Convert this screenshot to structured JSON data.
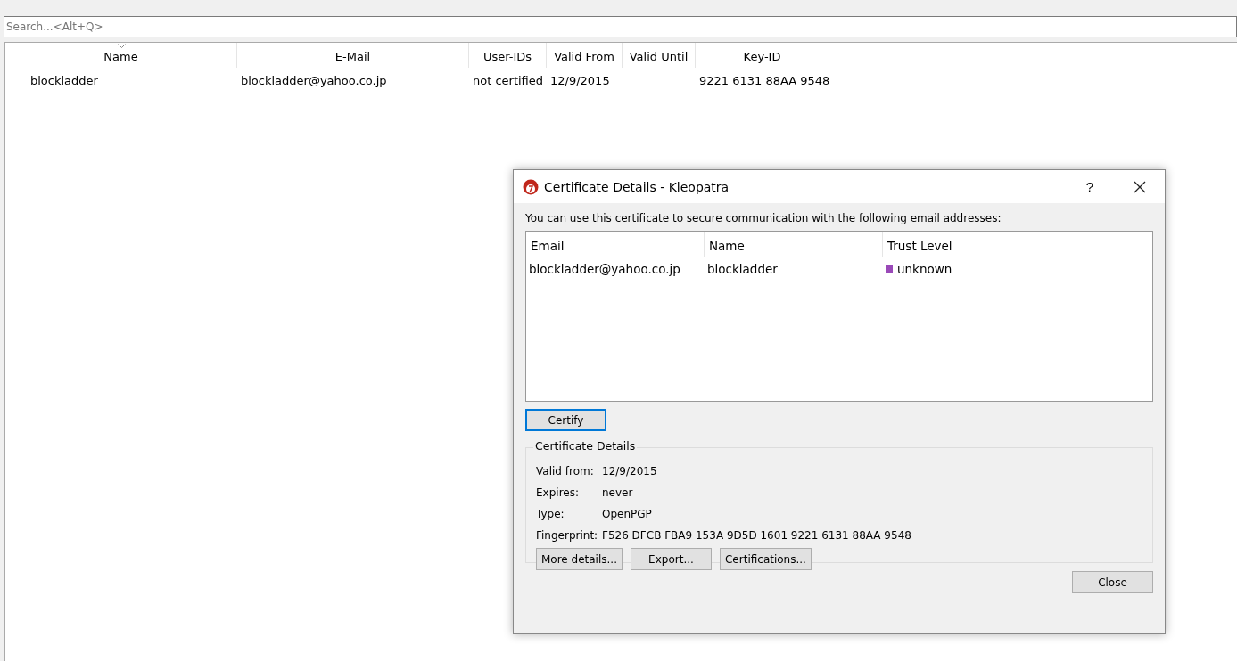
{
  "search": {
    "placeholder": "Search...<Alt+Q>"
  },
  "table": {
    "columns": [
      {
        "label": "Name",
        "sorted": true
      },
      {
        "label": "E-Mail",
        "sorted": false
      },
      {
        "label": "User-IDs",
        "sorted": false
      },
      {
        "label": "Valid From",
        "sorted": false
      },
      {
        "label": "Valid Until",
        "sorted": false
      },
      {
        "label": "Key-ID",
        "sorted": false
      }
    ],
    "rows": [
      [
        "blockladder",
        "blockladder@yahoo.co.jp",
        "not certified",
        "12/9/2015",
        "",
        "9221 6131 88AA 9548"
      ]
    ]
  },
  "dialog": {
    "title": "Certificate Details - Kleopatra",
    "help": "?",
    "intro": "You can use this certificate to secure communication with the following email addresses:",
    "list": {
      "columns": [
        "Email",
        "Name",
        "Trust Level"
      ],
      "rows": [
        {
          "email": "blockladder@yahoo.co.jp",
          "name": "blockladder",
          "trust": "unknown"
        }
      ]
    },
    "certify": "Certify",
    "group_title": "Certificate Details",
    "details": [
      {
        "label": "Valid from:",
        "value": "12/9/2015"
      },
      {
        "label": "Expires:",
        "value": "never"
      },
      {
        "label": "Type:",
        "value": "OpenPGP"
      },
      {
        "label": "Fingerprint:",
        "value": "F526 DFCB FBA9 153A 9D5D 1601 9221 6131 88AA 9548"
      }
    ],
    "buttons": [
      "More details...",
      "Export...",
      "Certifications..."
    ],
    "close": "Close"
  }
}
